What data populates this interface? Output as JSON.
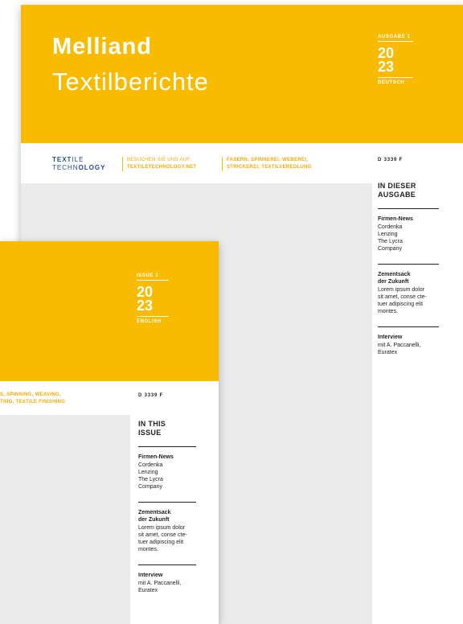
{
  "back_cover": {
    "title": "Melliand",
    "subtitle": "Textilberichte",
    "issue_label": "AUSGABE 1",
    "year_top": "20",
    "year_bottom": "23",
    "language": "DEUTSCH",
    "logo_line1_bold": "TEXT",
    "logo_line1_rest": "ILE",
    "logo_line2_a": "TECHN",
    "logo_line2_bold": "OLOGY",
    "visit_label": "BESUCHEN SIE UNS AUF:",
    "visit_url": "TEXTILETECHNOLOGY.NET",
    "topics_line1": "FASERN, SPINNEREI, WEBEREI,",
    "topics_line2": "STRICKEREI, TEXTILVEREDLUNG",
    "code": "D 3339 F",
    "toc_heading_1": "IN DIESER",
    "toc_heading_2": "AUSGABE",
    "sections": [
      {
        "title_1": "Firmen-News",
        "title_2": "",
        "body": [
          "Cordenka",
          "Lenzing",
          "The Lycra",
          "Company"
        ]
      },
      {
        "title_1": "Zementsack",
        "title_2": "der Zukunft",
        "body": [
          "Lorem ipsum dolor",
          "sit amet, conse cte-",
          "tuer adipiscing elit",
          "montes."
        ]
      },
      {
        "title_1": "Interview",
        "title_2": "",
        "body": [
          "mit A. Paccanelli,",
          "Euratex"
        ]
      }
    ]
  },
  "front_cover": {
    "issue_label": "ISSUE 1",
    "year_top": "20",
    "year_bottom": "23",
    "language": "ENGLISH",
    "topics_line1": "S, SPINNING, WEAVING,",
    "topics_line2": "TING, TEXTILE FINISHING",
    "code": "D 3339 F",
    "toc_heading_1": "IN THIS",
    "toc_heading_2": "ISSUE",
    "sections": [
      {
        "title_1": "Firmen-News",
        "title_2": "",
        "body": [
          "Cordenka",
          "Lenzing",
          "The Lycra",
          "Company"
        ]
      },
      {
        "title_1": "Zementsack",
        "title_2": "der Zukunft",
        "body": [
          "Lorem ipsum dolor",
          "sit amet, conse cte-",
          "tuer adipiscing elit",
          "montes."
        ]
      },
      {
        "title_1": "Interview",
        "title_2": "",
        "body": [
          "mit A. Paccanelli,",
          "Euratex"
        ]
      }
    ]
  },
  "colors": {
    "brand_yellow": "#f9bb00",
    "logo_blue": "#1d4f8c",
    "panel_gray": "#ebebeb"
  }
}
